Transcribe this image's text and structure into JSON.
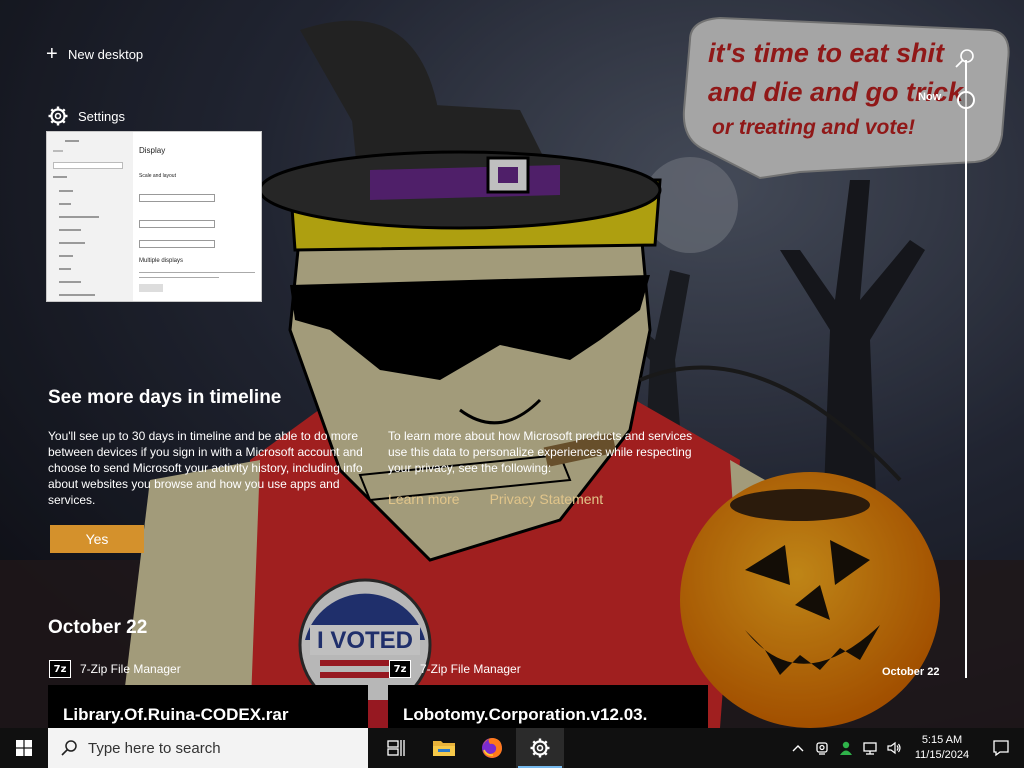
{
  "wallpaper": {
    "speech_bubble_text": [
      "it's time to eat shit",
      "and die and go trick",
      "or treating and vote!"
    ],
    "button_text": "I VOTED"
  },
  "timeline": {
    "new_desktop_label": "New desktop",
    "group_label": "Settings",
    "thumbnail": {
      "app_title": "Settings",
      "heading": "Display",
      "subheading": "Scale and layout",
      "section2": "Multiple displays",
      "nav_items": [
        "Home",
        "Find a setting",
        "System",
        "Display",
        "Sound",
        "Notifications & actions",
        "Focus assist",
        "Power & sleep",
        "Storage",
        "Tablet",
        "Multitasking",
        "Projecting to this PC"
      ]
    },
    "now_label": "Now",
    "side_date": "October 22"
  },
  "promo": {
    "title": "See more days in timeline",
    "left_text": "You'll see up to 30 days in timeline and be able to do more between devices if you sign in with a Microsoft account and choose to send Microsoft your activity history, including info about websites you browse and how you use apps and services.",
    "right_text": "To learn more about how Microsoft products and services use this data to personalize experiences while respecting your privacy, see the following:",
    "learn_more": "Learn more",
    "privacy": "Privacy Statement",
    "yes_label": "Yes"
  },
  "activity_group": {
    "date": "October 22",
    "items": [
      {
        "app": "7-Zip File Manager",
        "icon_text": "7z",
        "title": "Library.Of.Ruina-CODEX.rar"
      },
      {
        "app": "7-Zip File Manager",
        "icon_text": "7z",
        "title": "Lobotomy.Corporation.v12.03."
      }
    ]
  },
  "taskbar": {
    "search_placeholder": "Type here to search",
    "time": "5:15 AM",
    "date": "11/15/2024",
    "pinned": [
      "task-view-icon",
      "file-explorer-icon",
      "firefox-icon",
      "settings-icon"
    ]
  },
  "colors": {
    "accent": "#d4912c",
    "link": "#e1c58a",
    "taskbar": "#101010",
    "search_bg": "#f3f3f3"
  }
}
